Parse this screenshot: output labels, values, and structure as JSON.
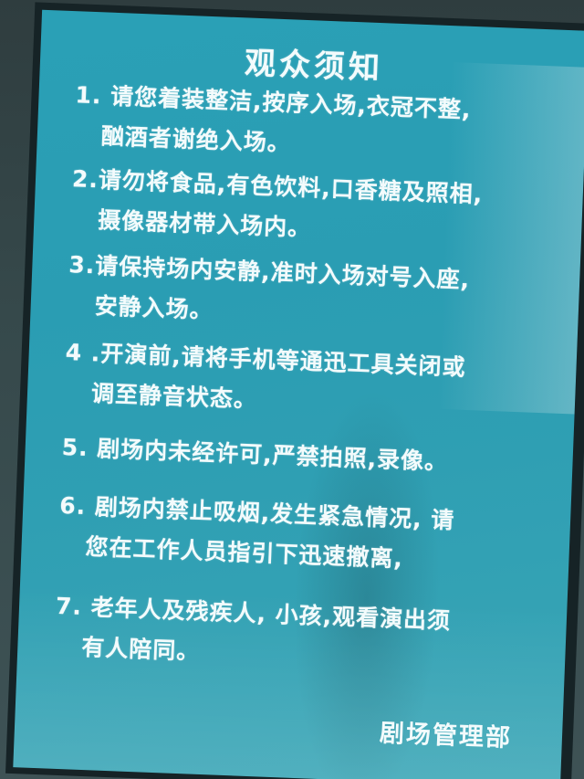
{
  "notice": {
    "title": "观众须知",
    "rules": [
      {
        "line1": "1. 请您着装整洁,按序入场,衣冠不整,",
        "line2": "酗酒者谢绝入场。"
      },
      {
        "line1": "2.请勿将食品,有色饮料,口香糖及照相,",
        "line2": "摄像器材带入场内。"
      },
      {
        "line1": "3.请保持场内安静,准时入场对号入座,",
        "line2": "安静入场。"
      },
      {
        "line1": "4 .开演前,请将手机等通迅工具关闭或",
        "line2": "调至静音状态。"
      },
      {
        "line1": "5. 剧场内未经许可,严禁拍照,录像。",
        "line2": ""
      },
      {
        "line1": "6. 剧场内禁止吸烟,发生紧急情况, 请",
        "line2": "您在工作人员指引下迅速撤离,"
      },
      {
        "line1": "7. 老年人及残疾人, 小孩,观看演出须",
        "line2": "有人陪同。"
      }
    ],
    "signature": "剧场管理部"
  },
  "colors": {
    "sign_background": "#2aa0b6",
    "text": "#f3fbfc",
    "frame": "#162326"
  }
}
